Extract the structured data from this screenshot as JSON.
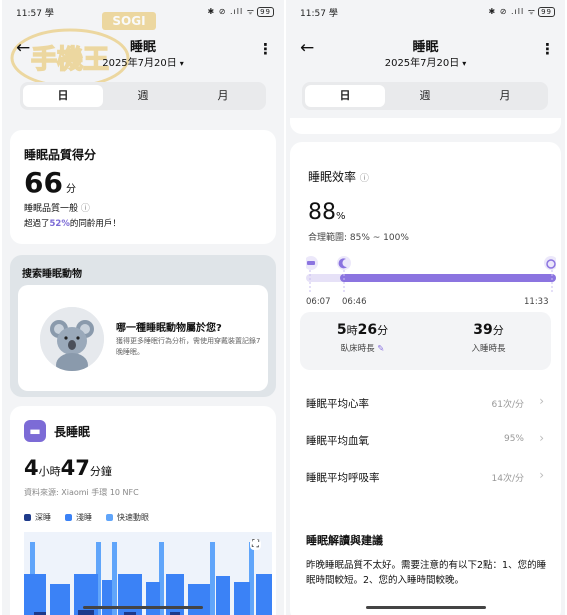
{
  "watermark": {
    "logo_text": "SOGI",
    "sub_text": "手機王"
  },
  "left": {
    "status": {
      "time": "11:57",
      "extra": "學",
      "icons": "✱ ⊘ .ıll ᯤ",
      "battery": "99"
    },
    "header": {
      "title": "睡眠",
      "date": "2025年7月20日",
      "caret": "▾",
      "back": "←",
      "more": "⋮"
    },
    "tabs": [
      {
        "label": "日",
        "active": true
      },
      {
        "label": "週",
        "active": false
      },
      {
        "label": "月",
        "active": false
      }
    ],
    "score": {
      "title": "睡眠品質得分",
      "value": "66",
      "unit": "分",
      "quality": "睡眠品質一般",
      "info_icon": "ⓘ",
      "compare_prefix": "超過了",
      "compare_pct": "52%",
      "compare_suffix": "的同齡用戶！"
    },
    "animal": {
      "heading": "搜索睡眠動物",
      "question": "哪一種睡眠動物屬於您?",
      "desc": "獲得更多睡眠行為分析，需使用穿戴裝置記錄7晚睡眠。"
    },
    "long_sleep": {
      "title": "長睡眠",
      "hours": "4",
      "hours_unit": "小時",
      "minutes": "47",
      "minutes_unit": "分鐘",
      "source": "資料來源: Xiaomi 手環 10 NFC",
      "legend": [
        {
          "label": "深睡",
          "color": "#1e3a8a"
        },
        {
          "label": "淺睡",
          "color": "#3b82f6"
        },
        {
          "label": "快速動眼",
          "color": "#60a5fa"
        }
      ],
      "expand_icon": "⛶"
    }
  },
  "right": {
    "status": {
      "time": "11:57",
      "extra": "學",
      "icons": "✱ ⊘ .ıll ᯤ",
      "battery": "99"
    },
    "header": {
      "title": "睡眠",
      "date": "2025年7月20日",
      "caret": "▾",
      "back": "←",
      "more": "⋮"
    },
    "tabs": [
      {
        "label": "日",
        "active": true
      },
      {
        "label": "週",
        "active": false
      },
      {
        "label": "月",
        "active": false
      }
    ],
    "efficiency": {
      "title": "睡眠效率",
      "info_icon": "ⓘ",
      "value": "88",
      "unit": "%",
      "range": "合理範圍: 85% ~ 100%",
      "bed_time": "06:07",
      "sleep_start": "06:46",
      "wake_time": "11:33",
      "fill_fraction": 0.88
    },
    "stats": [
      {
        "value": "5",
        "unit1": "時",
        "value2": "26",
        "unit2": "分",
        "label": "臥床時長",
        "edit_icon": "✎"
      },
      {
        "value": "39",
        "unit1": "分",
        "value2": "",
        "unit2": "",
        "label": "入睡時長",
        "edit_icon": ""
      }
    ],
    "metrics": [
      {
        "label": "睡眠平均心率",
        "value": "61次/分"
      },
      {
        "label": "睡眠平均血氧",
        "value": "95%"
      },
      {
        "label": "睡眠平均呼吸率",
        "value": "14次/分"
      }
    ],
    "advice": {
      "title": "睡眠解讀與建議",
      "text": "昨晚睡眠品質不太好。需要注意的有以下2點：1、您的睡眠時間較短。2、您的入睡時間較晚。"
    }
  }
}
